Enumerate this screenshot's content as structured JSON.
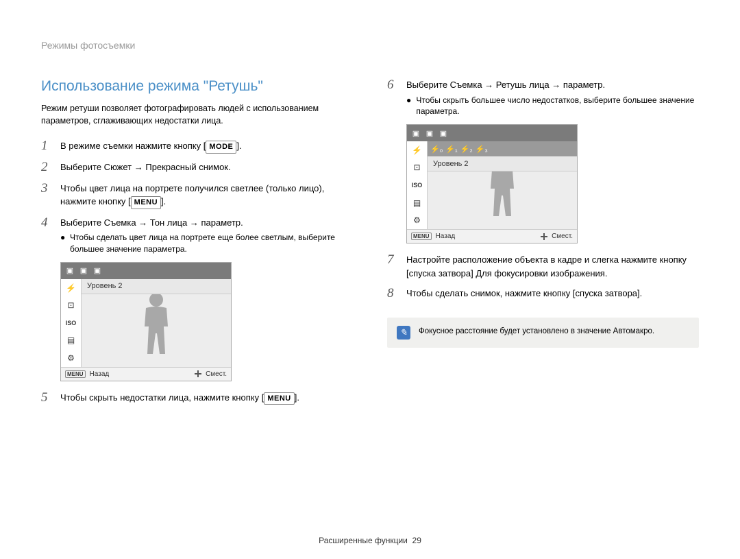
{
  "breadcrumb": "Режимы фотосъемки",
  "title": "Использование режима \"Ретушь\"",
  "intro": "Режим ретуши позволяет фотографировать людей с использованием параметров, сглаживающих недостатки лица.",
  "steps": {
    "s1_a": "В режиме съемки нажмите кнопку [",
    "s1_badge": "MODE",
    "s1_b": "].",
    "s2": "Выберите Сюжет → Прекрасный снимок.",
    "s3_a": "Чтобы цвет лица на портрете получился светлее (только лицо), нажмите кнопку [",
    "s3_badge": "MENU",
    "s3_b": "].",
    "s4": "Выберите Съемка → Тон лица → параметр.",
    "s4_bullet": "Чтобы сделать цвет лица на портрете еще более светлым, выберите большее значение параметра.",
    "s5_a": "Чтобы скрыть недостатки лица, нажмите кнопку [",
    "s5_badge": "MENU",
    "s5_b": "].",
    "s6": "Выберите Съемка → Ретушь лица → параметр.",
    "s6_bullet": "Чтобы скрыть большее число недостатков, выберите большее значение параметра.",
    "s7": "Настройте расположение объекта в кадре и слегка нажмите кнопку [спуска затвора] Для фокусировки изображения.",
    "s8": "Чтобы сделать снимок, нажмите кнопку [спуска затвора]."
  },
  "camera": {
    "level_label": "Уровень 2",
    "back_label": "Назад",
    "move_label": "Смест.",
    "menu_badge": "MENU"
  },
  "note": "Фокусное расстояние будет установлено в значение Автомакро.",
  "footer_label": "Расширенные функции",
  "footer_page": "29"
}
